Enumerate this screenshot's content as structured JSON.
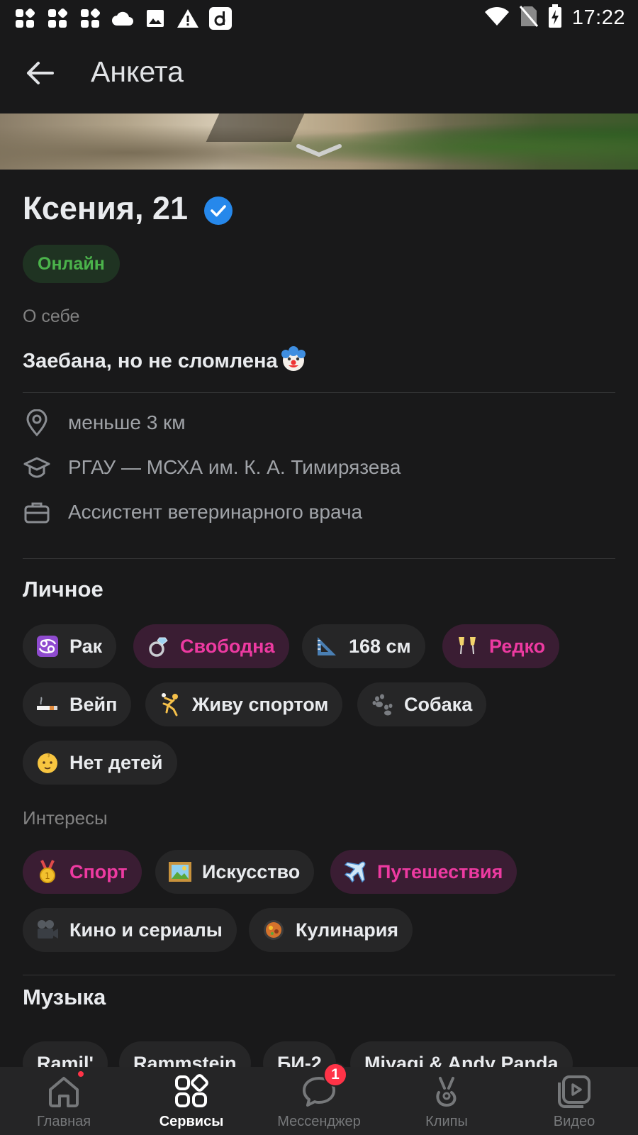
{
  "status_bar": {
    "time": "17:22"
  },
  "header": {
    "title": "Анкета"
  },
  "profile": {
    "name": "Ксения, 21",
    "status": "Онлайн",
    "about_label": "О себе",
    "about_text": "Заебана, но не сломлена",
    "about_emoji": "clown-face",
    "info": [
      {
        "icon": "location-pin-icon",
        "text": "меньше 3 км"
      },
      {
        "icon": "graduation-cap-icon",
        "text": "РГАУ — МСХА им. К. А. Тимирязева"
      },
      {
        "icon": "briefcase-icon",
        "text": "Ассистент ветеринарного врача"
      }
    ]
  },
  "personal": {
    "title": "Личное",
    "chips": [
      {
        "emoji": "♋",
        "label": "Рак"
      },
      {
        "emoji": "💍",
        "label": "Свободна"
      },
      {
        "emoji": "📐",
        "label": "168 см"
      },
      {
        "emoji": "🥂",
        "label": "Редко"
      },
      {
        "emoji": "🚬",
        "label": "Вейп"
      },
      {
        "emoji": "🤾",
        "label": "Живу спортом"
      },
      {
        "emoji": "🐾",
        "label": "Собака"
      },
      {
        "emoji": "👶",
        "label": "Нет детей"
      }
    ]
  },
  "interests": {
    "title": "Интересы",
    "chips": [
      {
        "emoji": "🏅",
        "label": "Спорт"
      },
      {
        "emoji": "🖼",
        "label": "Искусство"
      },
      {
        "emoji": "✈",
        "label": "Путешествия"
      },
      {
        "emoji": "🎥",
        "label": "Кино и сериалы"
      },
      {
        "emoji": "🥘",
        "label": "Кулинария"
      }
    ]
  },
  "music": {
    "title": "Музыка",
    "artists": [
      "Ramil'",
      "Rammstein",
      "БИ-2",
      "Miyagi & Andy Panda"
    ]
  },
  "bottom_nav": {
    "items": [
      {
        "label": "Главная",
        "icon": "home-icon"
      },
      {
        "label": "Сервисы",
        "icon": "services-icon"
      },
      {
        "label": "Мессенджер",
        "icon": "messenger-icon",
        "badge": "1"
      },
      {
        "label": "Клипы",
        "icon": "clips-icon"
      },
      {
        "label": "Видео",
        "icon": "video-icon"
      }
    ]
  },
  "colors": {
    "background": "#19191a",
    "accent_pink": "#ed3aa1",
    "online_green": "#4bb34b",
    "verified_blue": "#2688eb",
    "badge_red": "#ff3347"
  }
}
